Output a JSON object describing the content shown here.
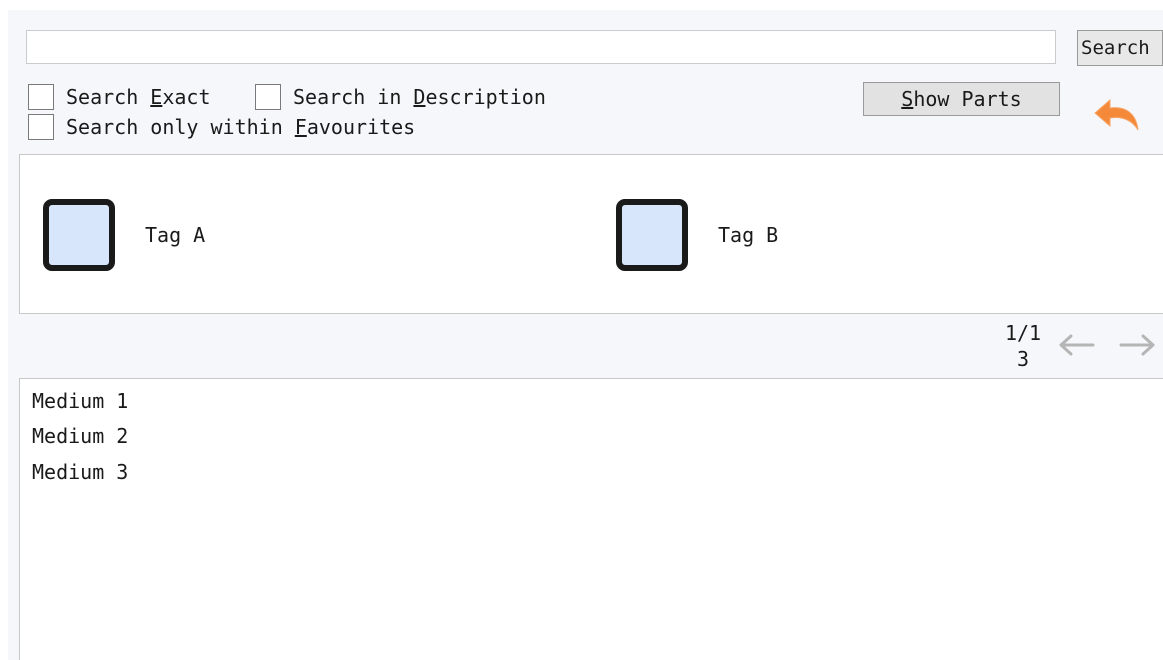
{
  "search": {
    "value": "",
    "button_label": "Search"
  },
  "options": {
    "exact": {
      "pre": "Search ",
      "key": "E",
      "post": "xact"
    },
    "description": {
      "pre": "Search in ",
      "key": "D",
      "post": "escription"
    },
    "favourites": {
      "pre": "Search only within ",
      "key": "F",
      "post": "avourites"
    }
  },
  "show_parts": {
    "key": "S",
    "post": "how Parts"
  },
  "icons": {
    "back": "undo-arrow-icon",
    "tag": "tag-square-icon",
    "prev": "arrow-left-icon",
    "next": "arrow-right-icon"
  },
  "colors": {
    "back_arrow": "#f5893a",
    "tag_fill": "#d8e6fb",
    "arrow_disabled": "#b5b5b5"
  },
  "tags": [
    {
      "label": "Tag A"
    },
    {
      "label": "Tag B"
    }
  ],
  "pagination": {
    "page": "1/1",
    "count": "3"
  },
  "media": [
    {
      "label": "Medium 1"
    },
    {
      "label": "Medium 2"
    },
    {
      "label": "Medium 3"
    }
  ]
}
